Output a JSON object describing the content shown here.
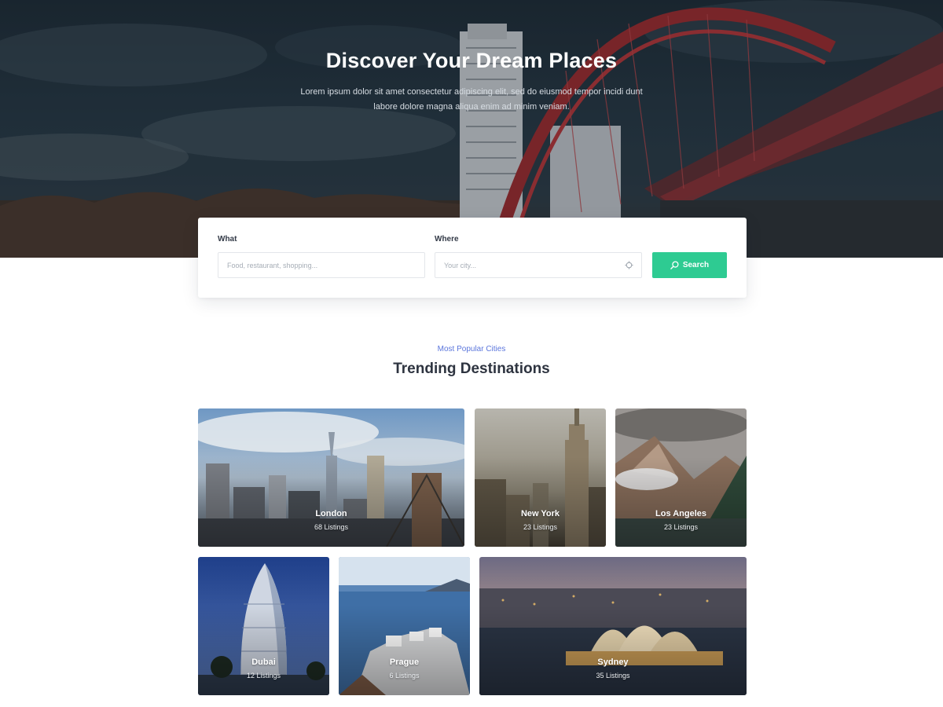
{
  "hero": {
    "title": "Discover Your Dream Places",
    "subtitle": "Lorem ipsum dolor sit amet consectetur adipiscing elit, sed do eiusmod tempor incidi dunt labore dolore magna aliqua enim ad minim veniam."
  },
  "search": {
    "what_label": "What",
    "what_placeholder": "Food, restaurant, shopping...",
    "where_label": "Where",
    "where_placeholder": "Your city...",
    "button_label": "Search",
    "button_color": "#2ecb92",
    "icons": {
      "button": "search-icon",
      "where": "crosshair-icon"
    }
  },
  "section": {
    "kicker": "Most Popular Cities",
    "title": "Trending Destinations",
    "kicker_color": "#5b76dc"
  },
  "cities": [
    {
      "name": "London",
      "count": "68 Listings"
    },
    {
      "name": "New York",
      "count": "23 Listings"
    },
    {
      "name": "Los Angeles",
      "count": "23 Listings"
    },
    {
      "name": "Dubai",
      "count": "12 Listings"
    },
    {
      "name": "Prague",
      "count": "6 Listings"
    },
    {
      "name": "Sydney",
      "count": "35 Listings"
    }
  ]
}
